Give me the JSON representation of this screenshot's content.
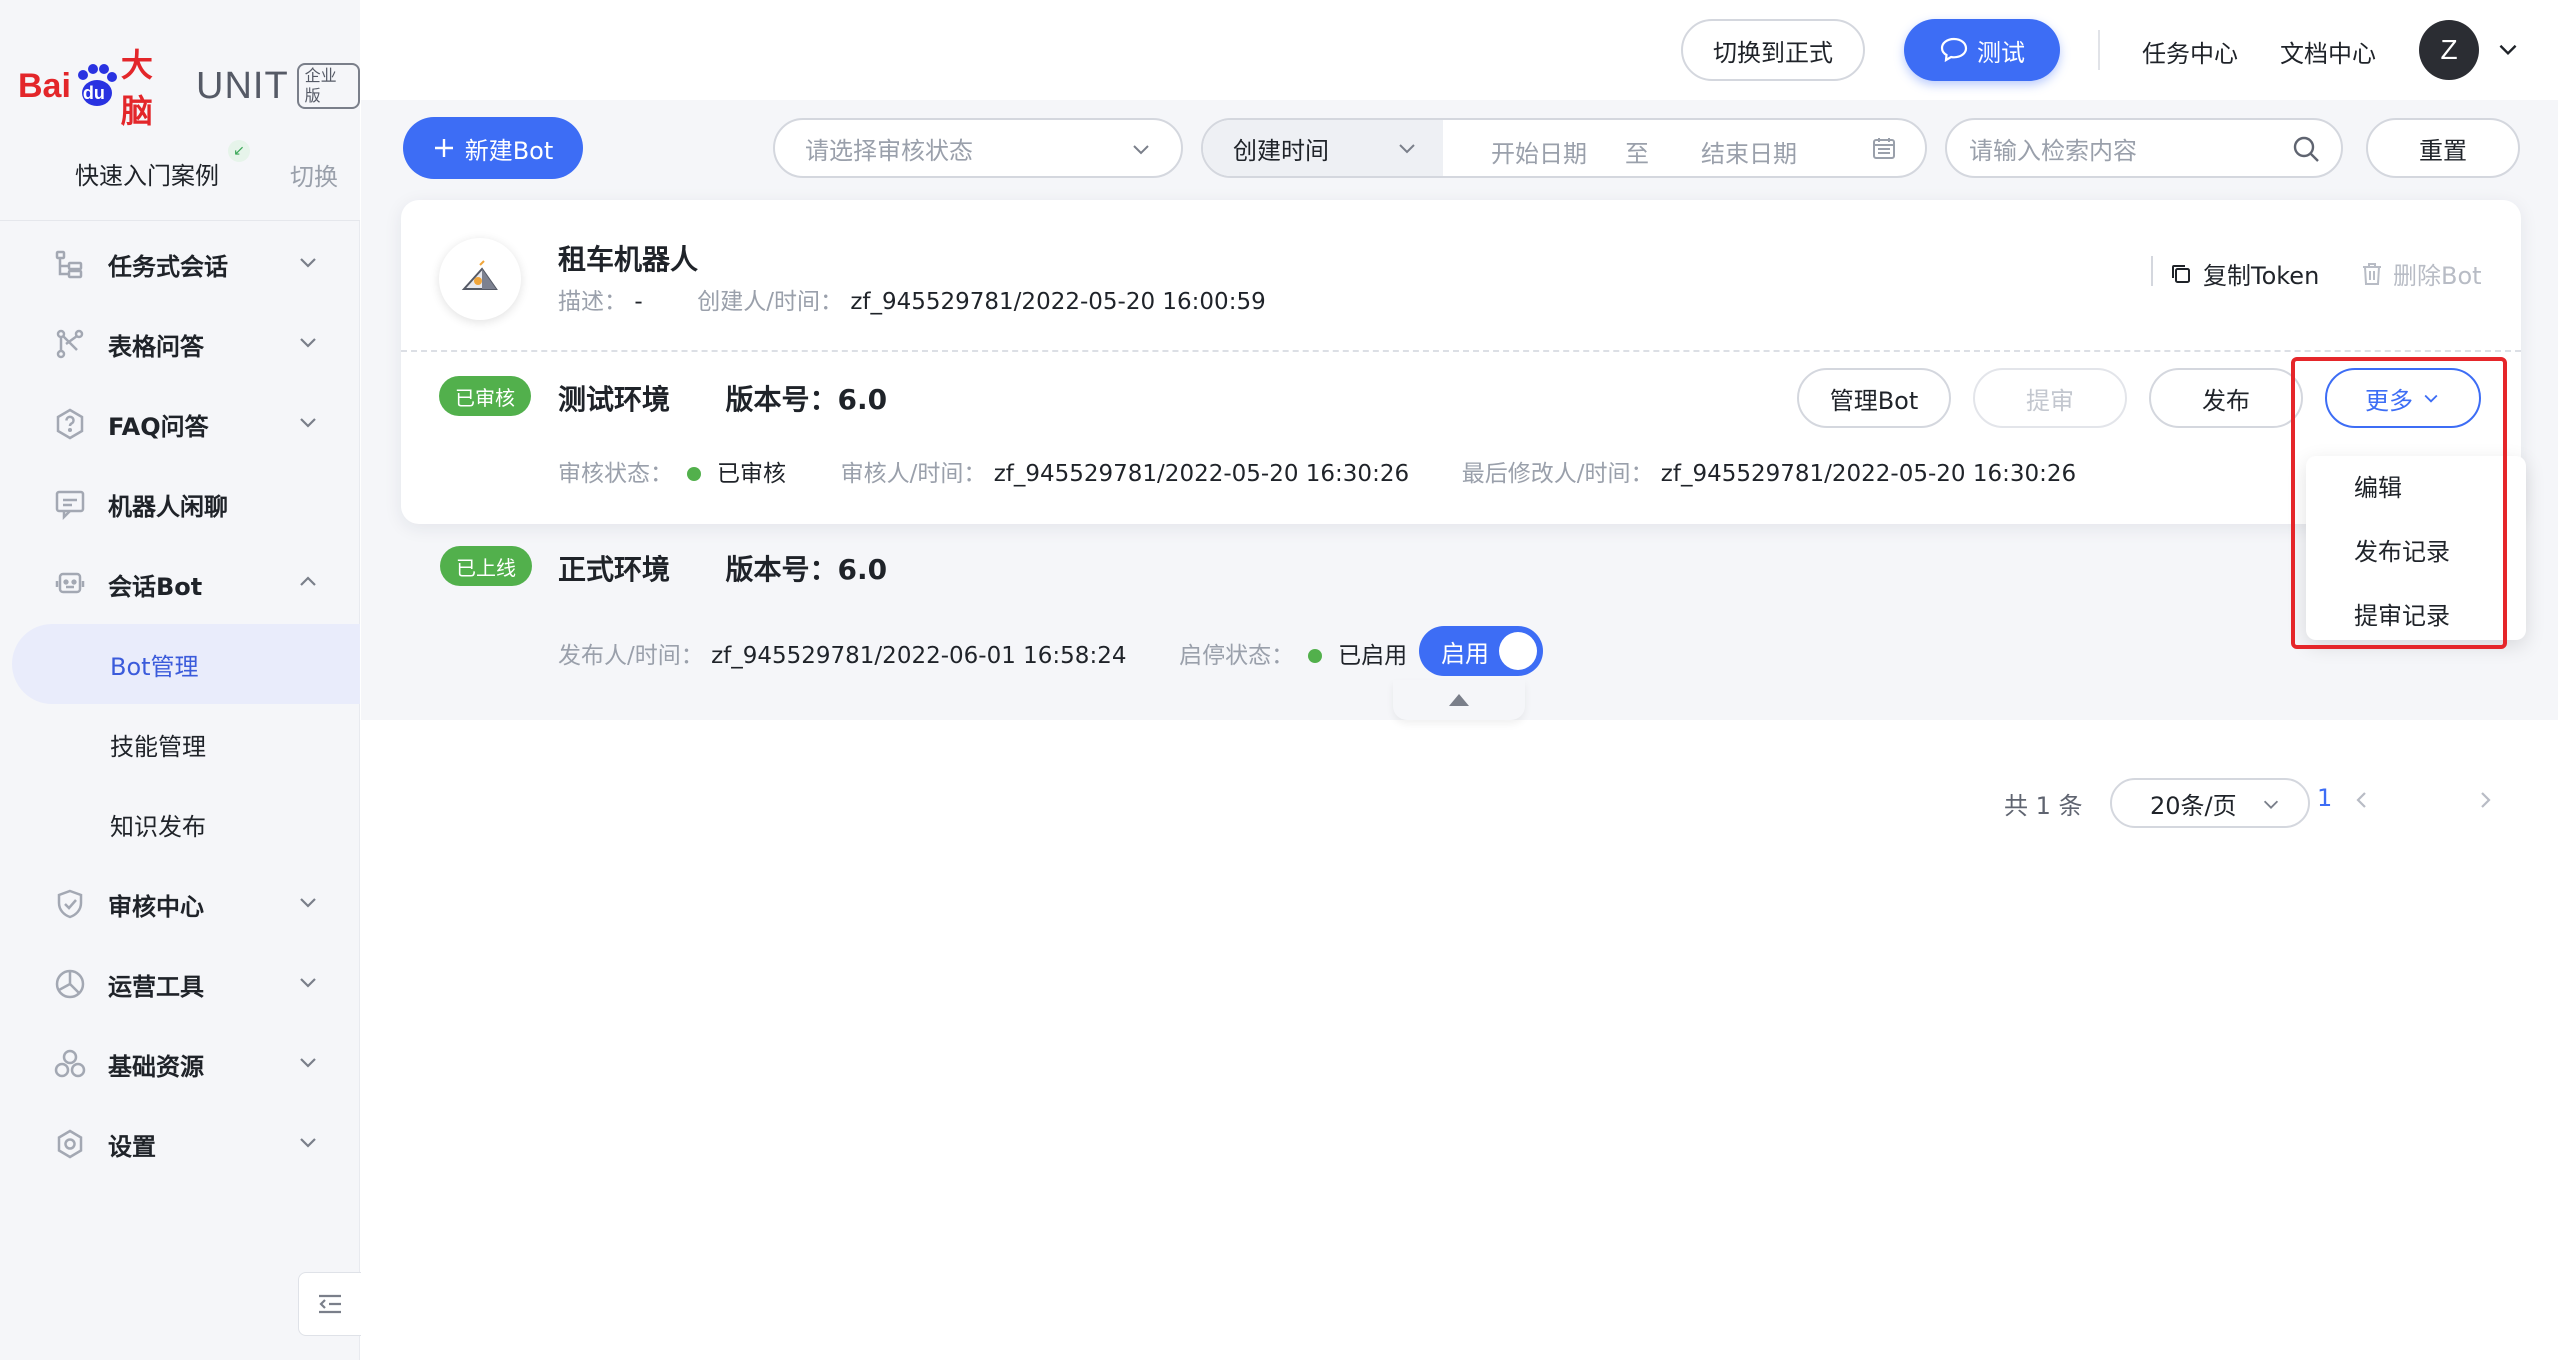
{
  "brand": {
    "logo_bai": "Bai",
    "logo_du": "du",
    "logo_danao": "大脑",
    "logo_unit": "UNIT",
    "edition": "企业版",
    "quick_entry": "快速入门案例",
    "switch": "切换"
  },
  "sidebar": {
    "items": [
      {
        "label": "任务式会话",
        "icon": "task-dialog-icon",
        "expanded": false
      },
      {
        "label": "表格问答",
        "icon": "table-qa-icon",
        "expanded": false
      },
      {
        "label": "FAQ问答",
        "icon": "faq-icon",
        "expanded": false
      },
      {
        "label": "机器人闲聊",
        "icon": "chat-icon",
        "expanded": false
      },
      {
        "label": "会话Bot",
        "icon": "bot-icon",
        "expanded": true
      }
    ],
    "bot_sub": [
      {
        "label": "Bot管理",
        "active": true
      },
      {
        "label": "技能管理",
        "active": false
      },
      {
        "label": "知识发布",
        "active": false
      }
    ],
    "items_after": [
      {
        "label": "审核中心",
        "icon": "shield-icon"
      },
      {
        "label": "运营工具",
        "icon": "ops-tool-icon"
      },
      {
        "label": "基础资源",
        "icon": "resource-icon"
      },
      {
        "label": "设置",
        "icon": "settings-icon"
      }
    ]
  },
  "header": {
    "switch_formal": "切换到正式",
    "test": "测试",
    "task_center": "任务中心",
    "doc_center": "文档中心",
    "avatar_letter": "Z"
  },
  "toolbar": {
    "new_bot": "新建Bot",
    "audit_status_placeholder": "请选择审核状态",
    "date_type": "创建时间",
    "start_date": "开始日期",
    "to": "至",
    "end_date": "结束日期",
    "search_placeholder": "请输入检索内容",
    "reset": "重置"
  },
  "bot": {
    "name": "租车机器人",
    "desc_label": "描述：",
    "desc_value": "-",
    "creator_label": "创建人/时间：",
    "creator_value": "zf_945529781/2022-05-20 16:00:59",
    "copy_token": "复制Token",
    "delete_bot": "删除Bot"
  },
  "test_env": {
    "tag": "已审核",
    "title": "测试环境",
    "version_label": "版本号：",
    "version": "6.0",
    "audit_status_label": "审核状态：",
    "audit_status": "已审核",
    "auditor_label": "审核人/时间：",
    "auditor_value": "zf_945529781/2022-05-20 16:30:26",
    "modifier_label": "最后修改人/时间：",
    "modifier_value": "zf_945529781/2022-05-20 16:30:26",
    "buttons": {
      "manage": "管理Bot",
      "submit": "提审",
      "publish": "发布",
      "more": "更多"
    }
  },
  "more_menu": [
    "编辑",
    "发布记录",
    "提审记录"
  ],
  "prod_env": {
    "tag": "已上线",
    "title": "正式环境",
    "version_label": "版本号：",
    "version": "6.0",
    "publisher_label": "发布人/时间：",
    "publisher_value": "zf_945529781/2022-06-01 16:58:24",
    "status_label": "启停状态：",
    "status": "已启用",
    "toggle_label": "启用",
    "toggle_on": true
  },
  "pagination": {
    "total": "共 1 条",
    "page_size": "20条/页",
    "current_page": "1"
  },
  "colors": {
    "primary": "#3d6df5",
    "success": "#52b04c",
    "highlight_box": "#e5262a"
  }
}
